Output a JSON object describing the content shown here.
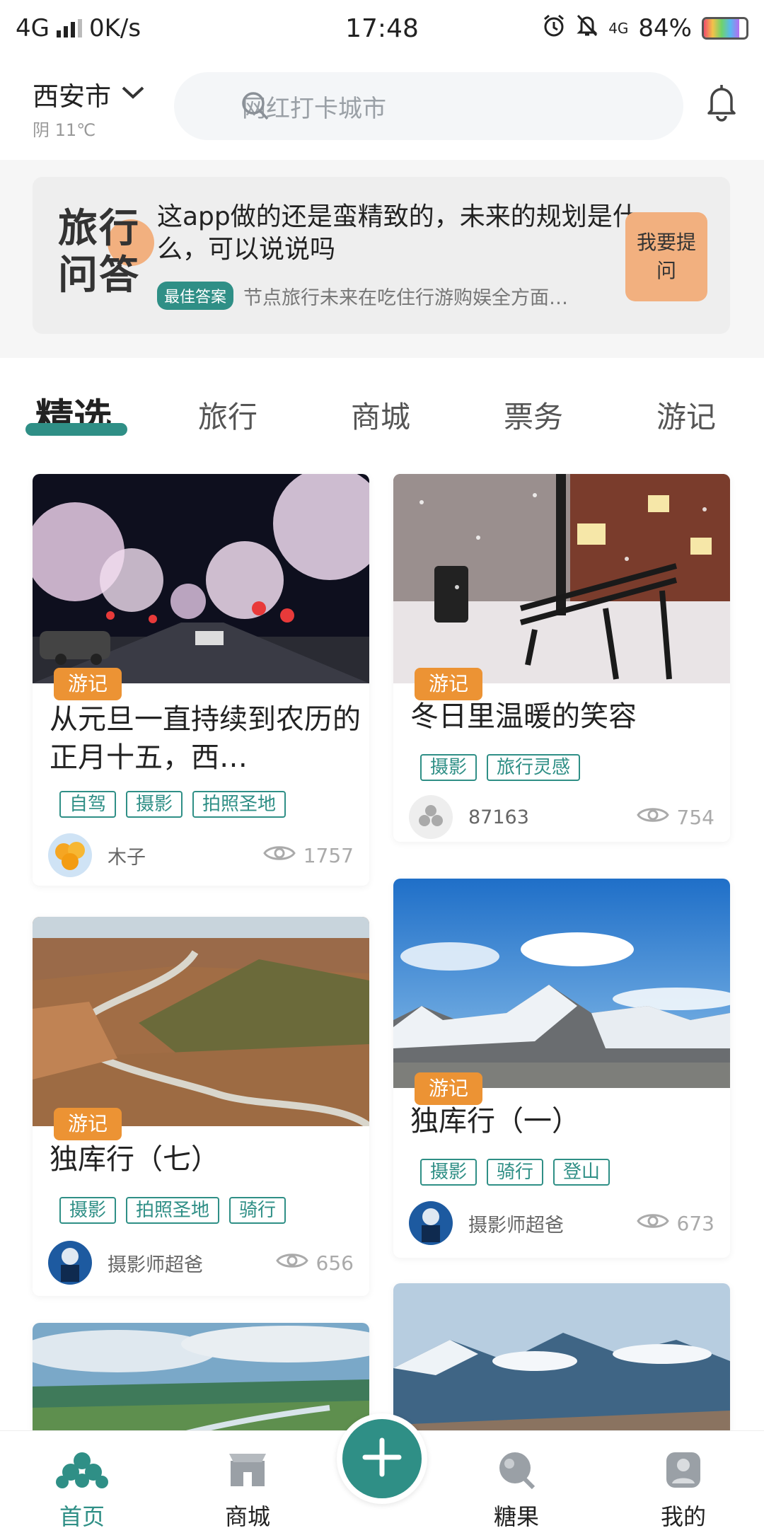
{
  "status_bar": {
    "network": "4G",
    "speed": "0K/s",
    "time": "17:48",
    "net2": "4G",
    "battery": "84%",
    "battery_level": 0.84
  },
  "header": {
    "city": "西安市",
    "weather": "阴 11℃",
    "search_placeholder": "网红打卡城市"
  },
  "qa": {
    "logo_line1": "旅行",
    "logo_line2": "问答",
    "question": "这app做的还是蛮精致的，未来的规划是什么，可以说说吗",
    "badge": "最佳答案",
    "answer": "节点旅行未来在吃住行游购娱全方面…",
    "ask_label": "我要提问",
    "accent": "#f2b07f"
  },
  "tabs": [
    "精选",
    "旅行",
    "商城",
    "票务",
    "游记"
  ],
  "cards": [
    {
      "category": "游记",
      "title": "从元旦一直持续到农历的正月十五，西…",
      "tags": [
        "自驾",
        "摄影",
        "拍照圣地"
      ],
      "author": "木子",
      "views": "1757"
    },
    {
      "category": "游记",
      "title": "冬日里温暖的笑容",
      "tags": [
        "摄影",
        "旅行灵感"
      ],
      "author": "87163",
      "views": "754"
    },
    {
      "category": "游记",
      "title": "独库行（七）",
      "tags": [
        "摄影",
        "拍照圣地",
        "骑行"
      ],
      "author": "摄影师超爸",
      "views": "656"
    },
    {
      "category": "游记",
      "title": "独库行（一）",
      "tags": [
        "摄影",
        "骑行",
        "登山"
      ],
      "author": "摄影师超爸",
      "views": "673"
    }
  ],
  "nav": {
    "home": "首页",
    "mall": "商城",
    "candy": "糖果",
    "mine": "我的"
  },
  "colors": {
    "accent": "#2f8f86",
    "category": "#ec9334"
  }
}
